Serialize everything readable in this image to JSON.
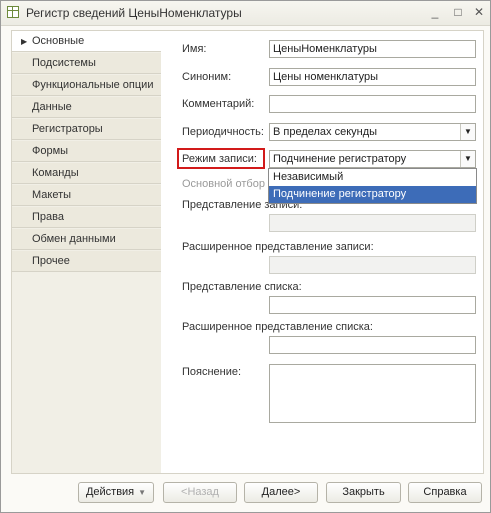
{
  "window": {
    "title": "Регистр сведений ЦеныНоменклатуры",
    "controls": [
      "_",
      "□",
      "✕"
    ]
  },
  "sidebar": {
    "items": [
      {
        "label": "Основные",
        "active": true
      },
      {
        "label": "Подсистемы"
      },
      {
        "label": "Функциональные опции"
      },
      {
        "label": "Данные"
      },
      {
        "label": "Регистраторы"
      },
      {
        "label": "Формы"
      },
      {
        "label": "Команды"
      },
      {
        "label": "Макеты"
      },
      {
        "label": "Права"
      },
      {
        "label": "Обмен данными"
      },
      {
        "label": "Прочее"
      }
    ]
  },
  "form": {
    "name_label": "Имя:",
    "name_value": "ЦеныНоменклатуры",
    "synonym_label": "Синоним:",
    "synonym_value": "Цены номенклатуры",
    "comment_label": "Комментарий:",
    "comment_value": "",
    "periodicity_label": "Периодичность:",
    "periodicity_value": "В пределах секунды",
    "write_mode_label": "Режим записи:",
    "write_mode_value": "Подчинение регистратору",
    "write_mode_options": [
      "Независимый",
      "Подчинение регистратору"
    ],
    "main_filter_label": "Основной отбор п",
    "record_presentation_label": "Представление записи:",
    "ext_record_presentation_label": "Расширенное представление записи:",
    "list_presentation_label": "Представление списка:",
    "ext_list_presentation_label": "Расширенное представление списка:",
    "explanation_label": "Пояснение:"
  },
  "buttons": {
    "actions": "Действия",
    "back": "<Назад",
    "next": "Далее>",
    "close": "Закрыть",
    "help": "Справка"
  },
  "colors": {
    "highlight_box": "#d21a1a",
    "selected_option": "#3d6cb8"
  }
}
